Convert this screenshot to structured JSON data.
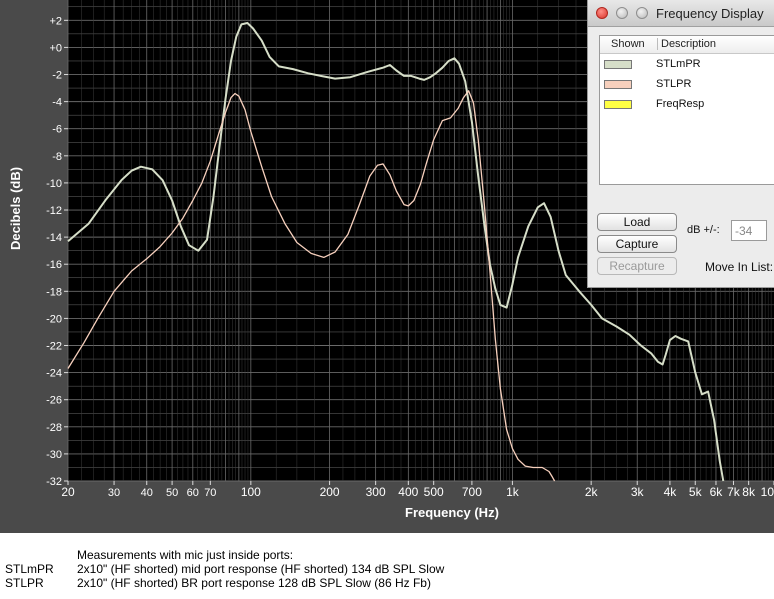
{
  "window": {
    "ylabel": "Decibels (dB)",
    "xlabel": "Frequency (Hz)"
  },
  "dialog": {
    "title": "Frequency Display",
    "columns": {
      "shown": "Shown",
      "description": "Description"
    },
    "rows": [
      {
        "label": "STLmPR",
        "swatch_color": "#d6dec8"
      },
      {
        "label": "STLPR",
        "swatch_color": "#f7d0bd"
      },
      {
        "label": "FreqResp",
        "swatch_color": "#ffff44"
      }
    ],
    "buttons": {
      "load": "Load",
      "capture": "Capture",
      "recapture": "Recapture"
    },
    "db_label": "dB +/-:",
    "db_value": "-34",
    "move_label": "Move In List:"
  },
  "notes": {
    "heading": "Measurements with mic just inside ports:",
    "lines": [
      {
        "name": "STLmPR",
        "desc": "2x10\" (HF shorted)  mid port response (HF shorted) 134 dB SPL Slow"
      },
      {
        "name": "STLPR",
        "desc": "2x10\" (HF shorted)  BR port response 128 dB SPL Slow (86 Hz Fb)"
      }
    ]
  },
  "chart_data": {
    "type": "line",
    "xlabel": "Frequency (Hz)",
    "ylabel": "Decibels (dB)",
    "xscale": "log",
    "xlim": [
      20,
      10000
    ],
    "ylim": [
      -32,
      3.5
    ],
    "grid": true,
    "background": "#000000",
    "grid_color": "#6a6a6a",
    "x_ticks": [
      {
        "v": 20,
        "label": "20"
      },
      {
        "v": 30,
        "label": "30"
      },
      {
        "v": 40,
        "label": "40"
      },
      {
        "v": 50,
        "label": "50"
      },
      {
        "v": 60,
        "label": "60"
      },
      {
        "v": 70,
        "label": "70"
      },
      {
        "v": 100,
        "label": "100"
      },
      {
        "v": 200,
        "label": "200"
      },
      {
        "v": 300,
        "label": "300"
      },
      {
        "v": 400,
        "label": "400"
      },
      {
        "v": 500,
        "label": "500"
      },
      {
        "v": 700,
        "label": "700"
      },
      {
        "v": 1000,
        "label": "1k"
      },
      {
        "v": 2000,
        "label": "2k"
      },
      {
        "v": 3000,
        "label": "3k"
      },
      {
        "v": 4000,
        "label": "4k"
      },
      {
        "v": 5000,
        "label": "5k"
      },
      {
        "v": 6000,
        "label": "6k"
      },
      {
        "v": 7000,
        "label": "7k"
      },
      {
        "v": 8000,
        "label": "8k"
      },
      {
        "v": 10000,
        "label": "10"
      }
    ],
    "y_ticks": [
      {
        "v": 2,
        "label": "+2"
      },
      {
        "v": 0,
        "label": "+0"
      },
      {
        "v": -2,
        "label": "-2"
      },
      {
        "v": -4,
        "label": "-4"
      },
      {
        "v": -6,
        "label": "-6"
      },
      {
        "v": -8,
        "label": "-8"
      },
      {
        "v": -10,
        "label": "-10"
      },
      {
        "v": -12,
        "label": "-12"
      },
      {
        "v": -14,
        "label": "-14"
      },
      {
        "v": -16,
        "label": "-16"
      },
      {
        "v": -18,
        "label": "-18"
      },
      {
        "v": -20,
        "label": "-20"
      },
      {
        "v": -22,
        "label": "-22"
      },
      {
        "v": -24,
        "label": "-24"
      },
      {
        "v": -26,
        "label": "-26"
      },
      {
        "v": -28,
        "label": "-28"
      },
      {
        "v": -30,
        "label": "-30"
      },
      {
        "v": -32,
        "label": "-32"
      }
    ],
    "series": [
      {
        "name": "STLmPR",
        "color": "#d6dec8",
        "points": [
          [
            20,
            -14.3
          ],
          [
            24,
            -13
          ],
          [
            28,
            -11.2
          ],
          [
            32,
            -9.8
          ],
          [
            35,
            -9.1
          ],
          [
            38,
            -8.8
          ],
          [
            42,
            -9
          ],
          [
            46,
            -9.8
          ],
          [
            50,
            -11.3
          ],
          [
            54,
            -13.2
          ],
          [
            58,
            -14.6
          ],
          [
            63,
            -15
          ],
          [
            68,
            -14.2
          ],
          [
            72,
            -11
          ],
          [
            76,
            -7.2
          ],
          [
            80,
            -3.8
          ],
          [
            84,
            -1
          ],
          [
            88,
            0.8
          ],
          [
            92,
            1.7
          ],
          [
            97,
            1.8
          ],
          [
            102,
            1.4
          ],
          [
            110,
            0.5
          ],
          [
            118,
            -0.7
          ],
          [
            128,
            -1.4
          ],
          [
            145,
            -1.6
          ],
          [
            165,
            -1.9
          ],
          [
            185,
            -2.1
          ],
          [
            210,
            -2.3
          ],
          [
            240,
            -2.2
          ],
          [
            280,
            -1.8
          ],
          [
            320,
            -1.5
          ],
          [
            340,
            -1.3
          ],
          [
            360,
            -1.7
          ],
          [
            385,
            -2.1
          ],
          [
            410,
            -2.1
          ],
          [
            440,
            -2.3
          ],
          [
            460,
            -2.4
          ],
          [
            485,
            -2.2
          ],
          [
            510,
            -1.9
          ],
          [
            540,
            -1.5
          ],
          [
            570,
            -1.0
          ],
          [
            600,
            -0.8
          ],
          [
            625,
            -1.2
          ],
          [
            660,
            -2.5
          ],
          [
            700,
            -5.5
          ],
          [
            740,
            -9.5
          ],
          [
            780,
            -13
          ],
          [
            820,
            -16
          ],
          [
            860,
            -17.8
          ],
          [
            900,
            -19
          ],
          [
            950,
            -19.2
          ],
          [
            1000,
            -17.5
          ],
          [
            1050,
            -15.5
          ],
          [
            1150,
            -13.2
          ],
          [
            1250,
            -11.8
          ],
          [
            1320,
            -11.5
          ],
          [
            1400,
            -12.5
          ],
          [
            1500,
            -15
          ],
          [
            1600,
            -16.8
          ],
          [
            1800,
            -18
          ],
          [
            2000,
            -19
          ],
          [
            2200,
            -20
          ],
          [
            2500,
            -20.6
          ],
          [
            2800,
            -21.2
          ],
          [
            3100,
            -22
          ],
          [
            3400,
            -22.6
          ],
          [
            3600,
            -23.2
          ],
          [
            3750,
            -23.4
          ],
          [
            3850,
            -22.7
          ],
          [
            4000,
            -21.6
          ],
          [
            4200,
            -21.3
          ],
          [
            4400,
            -21.5
          ],
          [
            4700,
            -21.7
          ],
          [
            5000,
            -24
          ],
          [
            5300,
            -25.6
          ],
          [
            5600,
            -25.4
          ],
          [
            5900,
            -27.5
          ],
          [
            6200,
            -30.5
          ],
          [
            6400,
            -32
          ]
        ]
      },
      {
        "name": "STLPR",
        "color": "#f7d0bd",
        "points": [
          [
            20,
            -23.7
          ],
          [
            23,
            -21.8
          ],
          [
            26,
            -20
          ],
          [
            30,
            -18
          ],
          [
            35,
            -16.5
          ],
          [
            40,
            -15.6
          ],
          [
            45,
            -14.7
          ],
          [
            50,
            -13.7
          ],
          [
            55,
            -12.6
          ],
          [
            60,
            -11.3
          ],
          [
            65,
            -10
          ],
          [
            70,
            -8.4
          ],
          [
            75,
            -6.5
          ],
          [
            80,
            -4.8
          ],
          [
            84,
            -3.7
          ],
          [
            87,
            -3.4
          ],
          [
            90,
            -3.6
          ],
          [
            95,
            -4.6
          ],
          [
            100,
            -6.2
          ],
          [
            110,
            -8.8
          ],
          [
            120,
            -11
          ],
          [
            135,
            -13
          ],
          [
            150,
            -14.4
          ],
          [
            170,
            -15.2
          ],
          [
            190,
            -15.5
          ],
          [
            210,
            -15.1
          ],
          [
            235,
            -13.8
          ],
          [
            260,
            -11.6
          ],
          [
            285,
            -9.5
          ],
          [
            305,
            -8.7
          ],
          [
            320,
            -8.6
          ],
          [
            340,
            -9.4
          ],
          [
            360,
            -10.6
          ],
          [
            385,
            -11.6
          ],
          [
            400,
            -11.7
          ],
          [
            420,
            -11.3
          ],
          [
            445,
            -10.1
          ],
          [
            470,
            -8.5
          ],
          [
            500,
            -6.8
          ],
          [
            540,
            -5.4
          ],
          [
            580,
            -5.2
          ],
          [
            620,
            -4.5
          ],
          [
            650,
            -3.7
          ],
          [
            680,
            -3.2
          ],
          [
            710,
            -4.1
          ],
          [
            740,
            -6.8
          ],
          [
            780,
            -11.5
          ],
          [
            820,
            -16.5
          ],
          [
            860,
            -21.5
          ],
          [
            900,
            -25.2
          ],
          [
            950,
            -28.2
          ],
          [
            1000,
            -29.6
          ],
          [
            1050,
            -30.4
          ],
          [
            1120,
            -30.9
          ],
          [
            1200,
            -31
          ],
          [
            1300,
            -31
          ],
          [
            1380,
            -31.3
          ],
          [
            1420,
            -31.7
          ],
          [
            1450,
            -32
          ]
        ]
      },
      {
        "name": "FreqResp",
        "color": "#ffff44",
        "points": []
      }
    ]
  }
}
